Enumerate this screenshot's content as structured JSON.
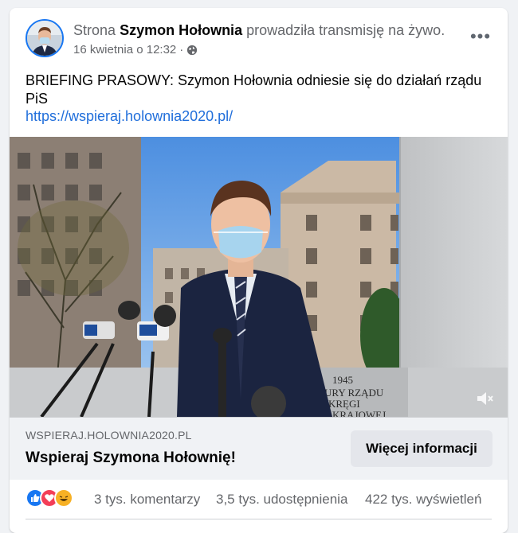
{
  "post": {
    "prefix": "Strona",
    "page_name": "Szymon Hołownia",
    "action": "prowadziła transmisję na żywo.",
    "date": "16 kwietnia o 12:32",
    "separator": "·",
    "privacy_icon": "globe-icon",
    "more_icon": "more-options-icon",
    "more_label": "•••",
    "text": "BRIEFING PRASOWY: Szymon Hołownia odniesie się do działań rządu PiS",
    "link": "https://wspieraj.holownia2020.pl/"
  },
  "video": {
    "plaque_year": "1945",
    "plaque_line2": "URY RZĄDU",
    "plaque_line3": "KRĘGI",
    "plaque_line4": "KRAJOWEJ",
    "mute_icon": "muted-speaker-icon"
  },
  "link_preview": {
    "domain": "WSPIERAJ.HOLOWNIA2020.PL",
    "title": "Wspieraj Szymona Hołownię!",
    "button_label": "Więcej informacji"
  },
  "stats": {
    "reactions": [
      "like-icon",
      "love-icon",
      "haha-icon"
    ],
    "comments": "3 tys. komentarzy",
    "shares": "3,5 tys. udostępnienia",
    "views": "422 tys. wyświetleń"
  },
  "colors": {
    "link": "#216fdb",
    "like": "#1877f2",
    "love": "#f33e58",
    "haha": "#f7b125"
  }
}
